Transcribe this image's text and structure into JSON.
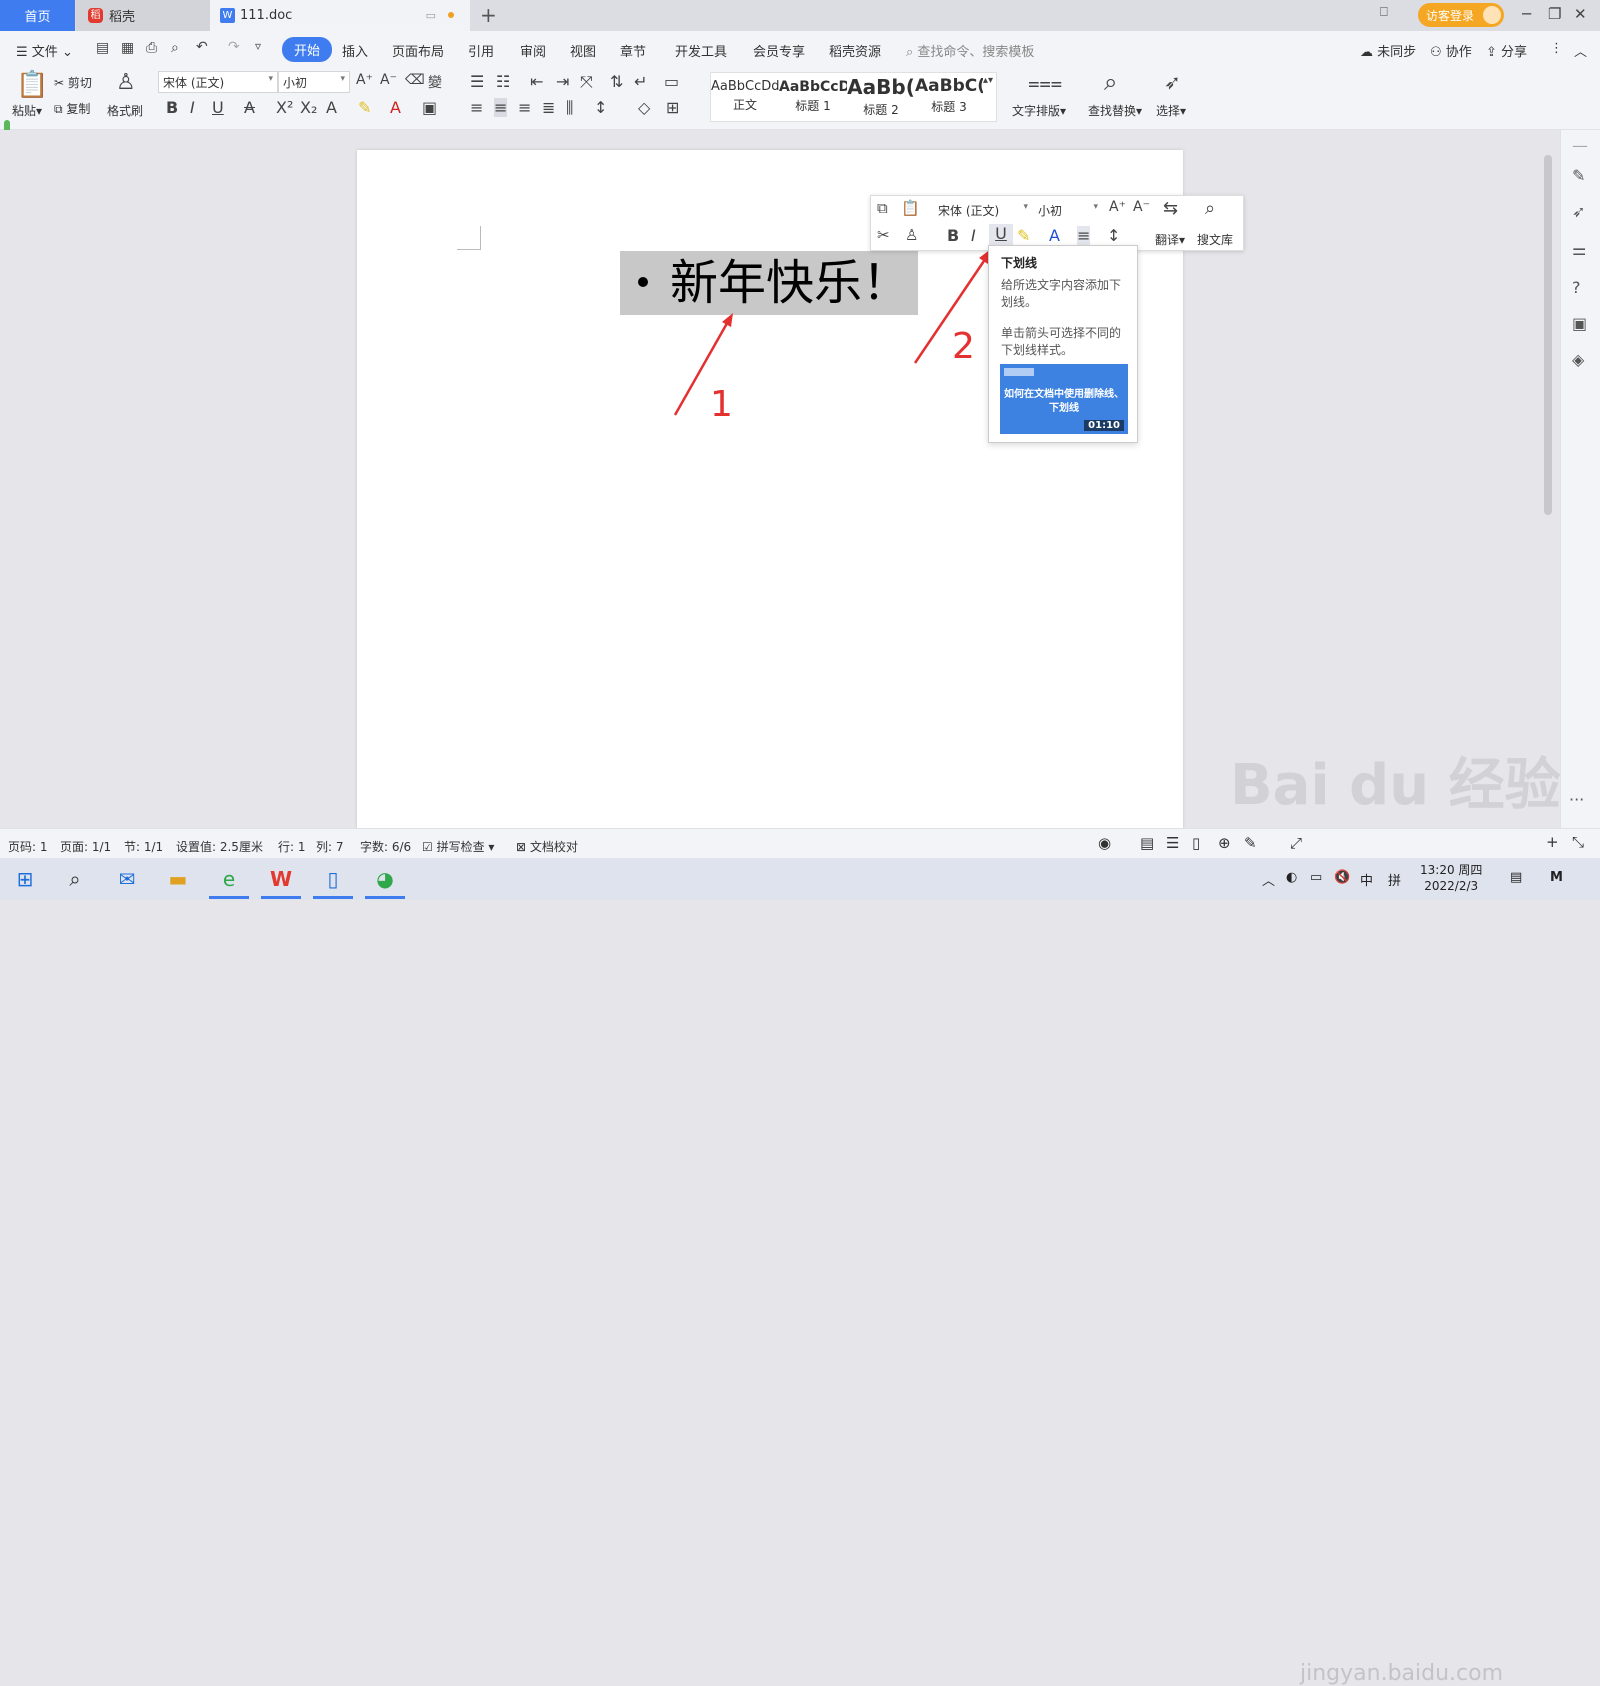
{
  "tabs": {
    "home": "首页",
    "daoke": "稻壳",
    "doc": "111.doc"
  },
  "window": {
    "guest_login": "访客登录"
  },
  "menu": {
    "file": "文件",
    "items": [
      "开始",
      "插入",
      "页面布局",
      "引用",
      "审阅",
      "视图",
      "章节",
      "开发工具",
      "会员专享",
      "稻壳资源"
    ],
    "search_placeholder": "查找命令、搜索模板",
    "sync": "未同步",
    "collab": "协作",
    "share": "分享"
  },
  "toolbar": {
    "paste": "粘贴",
    "cut": "剪切",
    "copy": "复制",
    "format_painter": "格式刷",
    "font": "宋体 (正文)",
    "size": "小初",
    "styles": [
      {
        "preview": "AaBbCcDd",
        "name": "正文"
      },
      {
        "preview": "AaBbCcD",
        "name": "标题 1"
      },
      {
        "preview": "AaBb(",
        "name": "标题 2"
      },
      {
        "preview": "AaBbC(",
        "name": "标题 3"
      }
    ],
    "text_layout": "文字排版",
    "find_replace": "查找替换",
    "select": "选择"
  },
  "document": {
    "text": "新年快乐！"
  },
  "mini_toolbar": {
    "font": "宋体 (正文)",
    "size": "小初",
    "translate": "翻译",
    "search_lib": "搜文库"
  },
  "tooltip": {
    "title": "下划线",
    "desc1": "给所选文字内容添加下划线。",
    "desc2": "单击箭头可选择不同的下划线样式。",
    "video_title": "如何在文档中使用删除线、下划线",
    "video_duration": "01:10"
  },
  "annotations": {
    "label1": "1",
    "label2": "2",
    "color": "#e53030"
  },
  "status": {
    "page_code": "页码: 1",
    "pages": "页面: 1/1",
    "section": "节: 1/1",
    "setting": "设置值: 2.5厘米",
    "row": "行: 1",
    "col": "列: 7",
    "words": "字数: 6/6",
    "spell": "拼写检查",
    "proof": "文档校对"
  },
  "taskbar": {
    "ime_cn": "中",
    "ime_pinyin": "拼",
    "time": "13:20 周四",
    "date": "2022/2/3"
  },
  "watermark": {
    "brand": "Bai du 经验",
    "url": "jingyan.baidu.com"
  },
  "accent": "#3e7cf0"
}
